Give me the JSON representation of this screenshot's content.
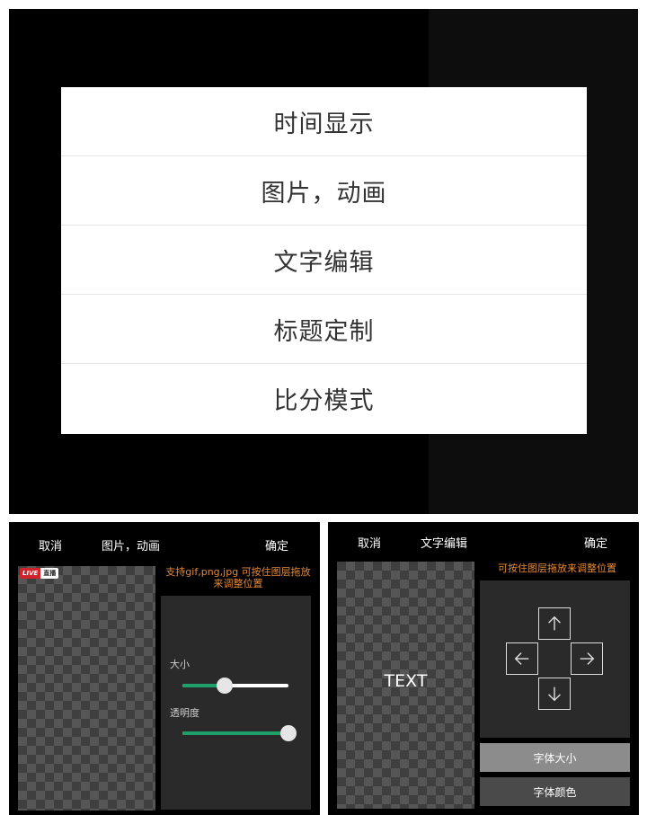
{
  "menu": {
    "items": [
      {
        "label": "时间显示"
      },
      {
        "label": "图片，动画"
      },
      {
        "label": "文字编辑"
      },
      {
        "label": "标题定制"
      },
      {
        "label": "比分模式"
      }
    ]
  },
  "image_panel": {
    "cancel": "取消",
    "title": "图片，动画",
    "confirm": "确定",
    "badge_live": "LIVE",
    "badge_zhibo": "直播",
    "hint": "支持gif,png,jpg 可按住图层拖放来调整位置",
    "size_label": "大小",
    "size_value": 0.4,
    "opacity_label": "透明度",
    "opacity_value": 1.0
  },
  "text_panel": {
    "cancel": "取消",
    "title": "文字编辑",
    "confirm": "确定",
    "preview_text": "TEXT",
    "hint": "可按住图层拖放来调整位置",
    "font_size_button": "字体大小",
    "font_color_button": "字体颜色"
  },
  "colors": {
    "accent_green": "#1fa06a",
    "hint_orange": "#e28a3a",
    "live_red": "#d0242c"
  }
}
